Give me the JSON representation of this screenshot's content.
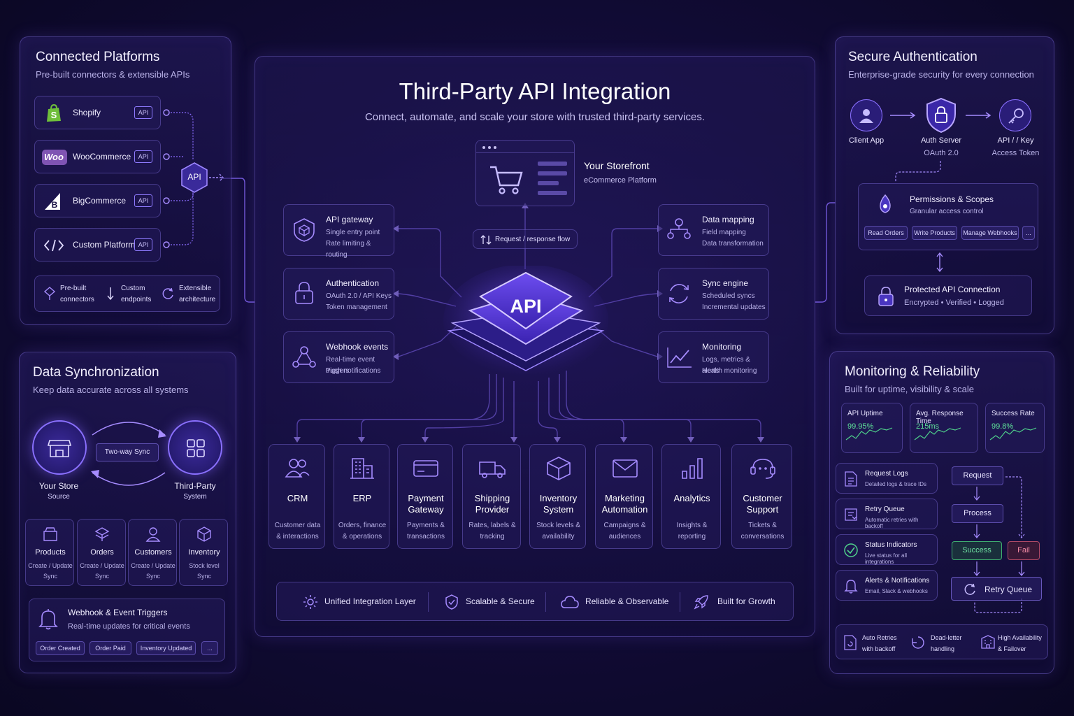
{
  "main": {
    "title": "Third-Party API Integration",
    "subtitle": "Connect, automate, and scale your store with trusted third-party services.",
    "storefront": {
      "title": "Your Storefront",
      "subtitle": "eCommerce Platform"
    },
    "flow_label": "Request / response flow",
    "hub_label": "API",
    "left_features": [
      {
        "title": "API gateway",
        "line1": "Single entry point",
        "line2": "Rate limiting & routing"
      },
      {
        "title": "Authentication",
        "line1": "OAuth 2.0 / API Keys",
        "line2": "Token management"
      },
      {
        "title": "Webhook events",
        "line1": "Real-time event triggers",
        "line2": "Push notifications"
      }
    ],
    "right_features": [
      {
        "title": "Data mapping",
        "line1": "Field mapping",
        "line2": "Data transformation"
      },
      {
        "title": "Sync engine",
        "line1": "Scheduled syncs",
        "line2": "Incremental updates"
      },
      {
        "title": "Monitoring",
        "line1": "Logs, metrics & alerts",
        "line2": "Health monitoring"
      }
    ],
    "services": [
      {
        "name1": "CRM",
        "name2": "",
        "desc1": "Customer data",
        "desc2": "& interactions"
      },
      {
        "name1": "ERP",
        "name2": "",
        "desc1": "Orders, finance",
        "desc2": "& operations"
      },
      {
        "name1": "Payment",
        "name2": "Gateway",
        "desc1": "Payments &",
        "desc2": "transactions"
      },
      {
        "name1": "Shipping",
        "name2": "Provider",
        "desc1": "Rates, labels &",
        "desc2": "tracking"
      },
      {
        "name1": "Inventory",
        "name2": "System",
        "desc1": "Stock levels &",
        "desc2": "availability"
      },
      {
        "name1": "Marketing",
        "name2": "Automation",
        "desc1": "Campaigns &",
        "desc2": "audiences"
      },
      {
        "name1": "Analytics",
        "name2": "",
        "desc1": "Insights &",
        "desc2": "reporting"
      },
      {
        "name1": "Customer",
        "name2": "Support",
        "desc1": "Tickets &",
        "desc2": "conversations"
      }
    ],
    "footer": [
      "Unified Integration Layer",
      "Scalable & Secure",
      "Reliable & Observable",
      "Built for Growth"
    ]
  },
  "platforms": {
    "title": "Connected Platforms",
    "subtitle": "Pre-built connectors & extensible APIs",
    "items": [
      {
        "name": "Shopify",
        "tag": "API"
      },
      {
        "name": "WooCommerce",
        "tag": "API"
      },
      {
        "name": "BigCommerce",
        "tag": "API"
      },
      {
        "name": "Custom Platform",
        "tag": "API"
      }
    ],
    "hub": "API",
    "woo_logo": "Woo",
    "features": [
      {
        "l1": "Pre-built",
        "l2": "connectors"
      },
      {
        "l1": "Custom",
        "l2": "endpoints"
      },
      {
        "l1": "Extensible",
        "l2": "architecture"
      }
    ]
  },
  "sync": {
    "title": "Data Synchronization",
    "subtitle": "Keep data accurate across all systems",
    "store": {
      "name": "Your Store",
      "role": "Source"
    },
    "third": {
      "name": "Third-Party",
      "role": "System"
    },
    "two_way": "Two-way Sync",
    "entities": [
      {
        "name": "Products",
        "l1": "Create / Update",
        "l2": "Sync"
      },
      {
        "name": "Orders",
        "l1": "Create / Update",
        "l2": "Sync"
      },
      {
        "name": "Customers",
        "l1": "Create / Update",
        "l2": "Sync"
      },
      {
        "name": "Inventory",
        "l1": "Stock level",
        "l2": "Sync"
      }
    ],
    "webhook": {
      "title": "Webhook & Event Triggers",
      "subtitle": "Real-time updates for critical events",
      "tags": [
        "Order Created",
        "Order Paid",
        "Inventory Updated",
        "..."
      ]
    }
  },
  "auth": {
    "title": "Secure Authentication",
    "subtitle": "Enterprise-grade security for every connection",
    "client": "Client App",
    "server": {
      "name": "Auth Server",
      "sub": "OAuth 2.0"
    },
    "key": {
      "name": "API / / Key",
      "sub": "Access Token"
    },
    "permissions": {
      "title": "Permissions & Scopes",
      "subtitle": "Granular access control",
      "scopes": [
        "Read Orders",
        "Write Products",
        "Manage Webhooks",
        "..."
      ]
    },
    "protected": {
      "title": "Protected API Connection",
      "subtitle": "Encrypted • Verified • Logged"
    }
  },
  "monitoring": {
    "title": "Monitoring & Reliability",
    "subtitle": "Built for uptime, visibility & scale",
    "metrics": [
      {
        "label": "API Uptime",
        "value": "99.95%"
      },
      {
        "label": "Avg. Response Time",
        "value": "215ms"
      },
      {
        "label": "Success Rate",
        "value": "99.8%"
      }
    ],
    "items": [
      {
        "title": "Request Logs",
        "sub": "Detailed logs & trace IDs"
      },
      {
        "title": "Retry Queue",
        "sub": "Automatic retries with backoff"
      },
      {
        "title": "Status Indicators",
        "sub": "Live status for all integrations"
      },
      {
        "title": "Alerts & Notifications",
        "sub": "Email, Slack & webhooks"
      }
    ],
    "flow": {
      "request": "Request",
      "process": "Process",
      "success": "Success",
      "fail": "Fail",
      "retry": "Retry Queue"
    },
    "bottom": [
      {
        "l1": "Auto Retries",
        "l2": "with backoff"
      },
      {
        "l1": "Dead-letter",
        "l2": "handling"
      },
      {
        "l1": "High Availability",
        "l2": "& Failover"
      }
    ]
  }
}
